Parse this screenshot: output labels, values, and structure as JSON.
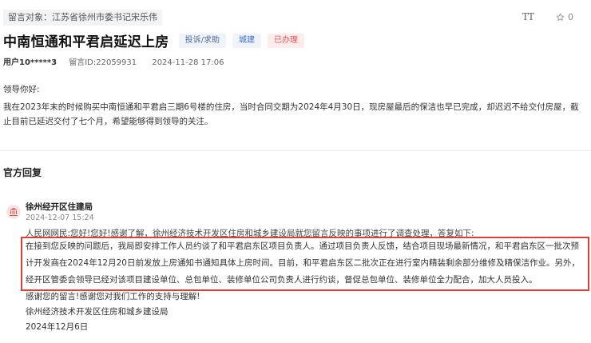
{
  "header": {
    "target_label": "留言对象：江苏省徐州市委书记宋乐伟",
    "font_tool": "TT",
    "star_count": "0"
  },
  "message": {
    "title": "中南恒通和平君启延迟上房",
    "tags": {
      "type": "投诉/求助",
      "category": "城建",
      "status": "已办理"
    },
    "user": "用户10*****3",
    "id": "留言ID:22059931",
    "time": "2024-11-28 17:06",
    "greeting": "领导你好:",
    "body": "我在2023年末的时候购买中南恒通和平君启三期6号楼的住房，当时合同交期为2024年4月30日，现房屋最后的保洁也早已完成，却迟迟不给交付房屋，截止目前已延迟交付了七个月，希望能够得到领导的关注。"
  },
  "reply": {
    "section_title": "官方回复",
    "org": "徐州经开区住建局",
    "date": "2024-12-07 15:24",
    "lead": "人民网网民:您好!您好!感谢了解，徐州经济技术开发区住房和城乡建设局就您留言反映的事项进行了调查处理，答复如下:",
    "highlight": "在接到您反映的问题后，我局即安排工作人员约谈了和平君启东区项目负责人。通过项目负责人反馈，结合项目现场最新情况，和平君启东区一批次预计开发商在2024年12月20日前发放上房通知书通知具体上房时间。目前，和平君启东区二批次正在进行室内精装剩余部分维修及精保洁作业。另外，经开区管委会领导已经对该项目建设单位、总包单位、装修单位公司负责人进行约谈，督促总包单位、装修单位全力配合，加大人员投入。",
    "thanks": "感谢您的留言!感谢您对我们工作的支持与理解!",
    "signature": "徐州经济技术开发区住房和城乡建设局",
    "sign_date": "2024年12月6日"
  }
}
